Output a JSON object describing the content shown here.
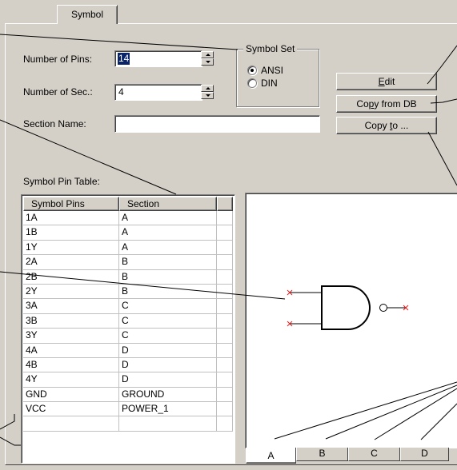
{
  "tabs": {
    "active": "Symbol"
  },
  "form": {
    "pins_label": "Number of Pins:",
    "pins_value": "14",
    "sections_label": "Number of Sec.:",
    "sections_value": "4",
    "section_name_label": "Section Name:",
    "section_name_value": ""
  },
  "symbol_set": {
    "title": "Symbol Set",
    "options": [
      {
        "label": "ANSI",
        "checked": true
      },
      {
        "label": "DIN",
        "checked": false
      }
    ]
  },
  "buttons": {
    "edit": {
      "label": "Edit",
      "underline": "E",
      "rest": "dit"
    },
    "copy_from_db": {
      "pre": "Co",
      "underline": "p",
      "rest": "y from DB"
    },
    "copy_to": {
      "pre": "Copy ",
      "underline": "t",
      "rest": "o ..."
    }
  },
  "pin_table": {
    "label": "Symbol Pin Table:",
    "columns": [
      "Symbol Pins",
      "Section"
    ],
    "rows": [
      [
        "1A",
        "A"
      ],
      [
        "1B",
        "A"
      ],
      [
        "1Y",
        "A"
      ],
      [
        "2A",
        "B"
      ],
      [
        "2B",
        "B"
      ],
      [
        "2Y",
        "B"
      ],
      [
        "3A",
        "C"
      ],
      [
        "3B",
        "C"
      ],
      [
        "3Y",
        "C"
      ],
      [
        "4A",
        "D"
      ],
      [
        "4B",
        "D"
      ],
      [
        "4Y",
        "D"
      ],
      [
        "GND",
        "GROUND"
      ],
      [
        "VCC",
        "POWER_1"
      ],
      [
        "",
        ""
      ]
    ]
  },
  "section_tabs": [
    "A",
    "B",
    "C",
    "D"
  ],
  "colors": {
    "face": "#d4d0c8",
    "selection": "#0a246a",
    "pin_marker": "#e02020"
  }
}
